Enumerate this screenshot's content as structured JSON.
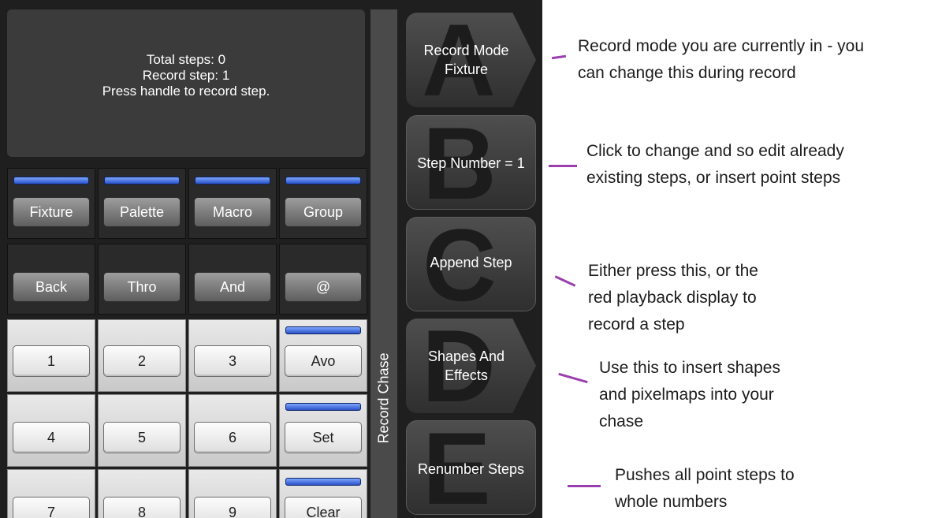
{
  "display": {
    "line1": "Total steps: 0",
    "line2": "Record step: 1",
    "line3": "Press handle to record step."
  },
  "select_row": [
    "Fixture",
    "Palette",
    "Macro",
    "Group"
  ],
  "op_row": [
    "Back",
    "Thro",
    "And",
    "@"
  ],
  "keypad": {
    "k1": "1",
    "k2": "2",
    "k3": "3",
    "avo": "Avo",
    "k4": "4",
    "k5": "5",
    "k6": "6",
    "set": "Set",
    "k7": "7",
    "k8": "8",
    "k9": "9",
    "clear": "Clear"
  },
  "strip_label": "Record Chase",
  "softkeys": [
    {
      "letter": "A",
      "label": "Record Mode\nFixture"
    },
    {
      "letter": "B",
      "label": "Step Number = 1"
    },
    {
      "letter": "C",
      "label": "Append Step"
    },
    {
      "letter": "D",
      "label": "Shapes And\nEffects"
    },
    {
      "letter": "E",
      "label": "Renumber Steps"
    }
  ],
  "annotations": [
    {
      "text": "Record mode you are currently in - you\ncan change this during record"
    },
    {
      "text": "Click to change and so edit already\nexisting steps, or insert point steps"
    },
    {
      "text": "Either press this, or the\nred playback display to\nrecord a step"
    },
    {
      "text": "Use this to insert shapes\nand pixelmaps into your\nchase"
    },
    {
      "text": "Pushes all point steps to\nwhole numbers"
    }
  ],
  "colors": {
    "annotation_mark": "#9b3fae",
    "led": "#3b63d8"
  }
}
